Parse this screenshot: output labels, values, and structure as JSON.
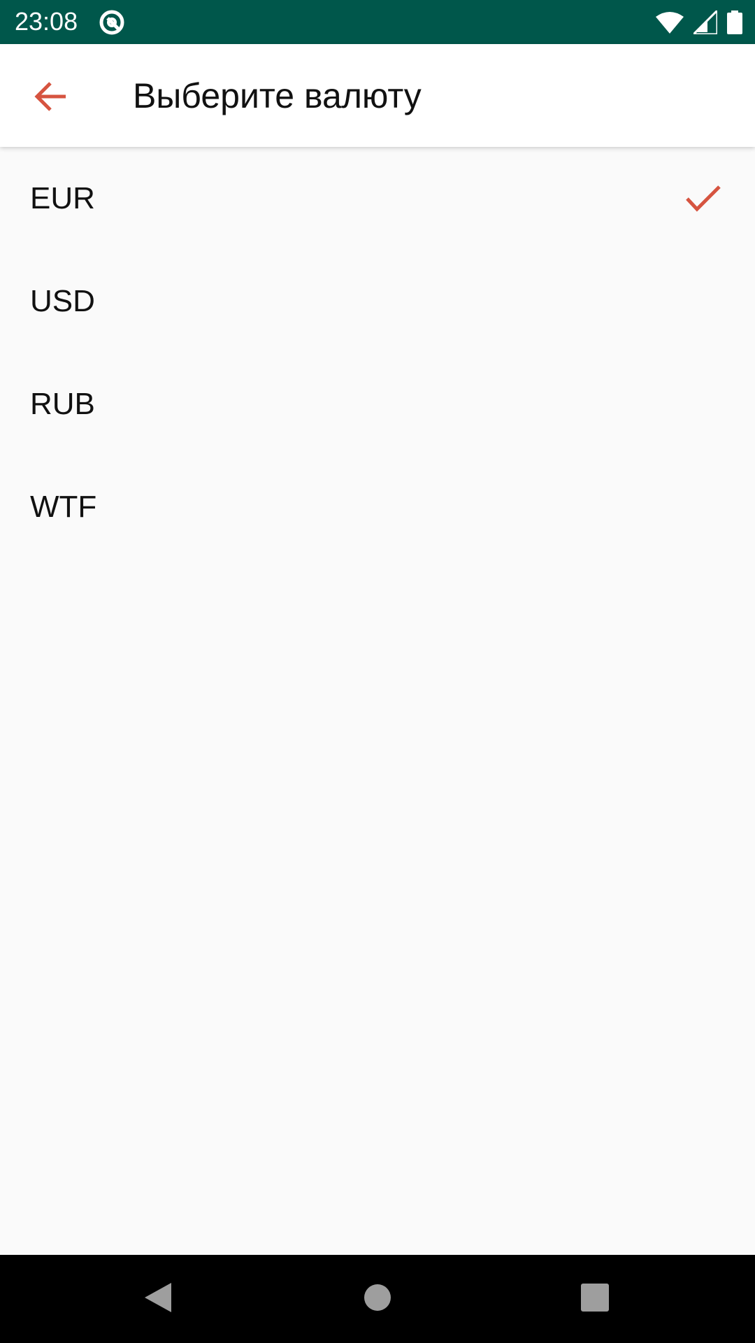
{
  "status_bar": {
    "time": "23:08",
    "background": "#00574b",
    "icons": [
      "app-notification-icon",
      "wifi-icon",
      "signal-icon",
      "battery-icon"
    ]
  },
  "app_bar": {
    "title": "Выберите валюту",
    "back_icon": "arrow-back-icon",
    "accent_color": "#d65440"
  },
  "currencies": [
    {
      "code": "EUR",
      "selected": true
    },
    {
      "code": "USD",
      "selected": false
    },
    {
      "code": "RUB",
      "selected": false
    },
    {
      "code": "WTF",
      "selected": false
    }
  ],
  "nav_bar": {
    "icons": [
      "nav-back-icon",
      "nav-home-icon",
      "nav-recents-icon"
    ]
  }
}
